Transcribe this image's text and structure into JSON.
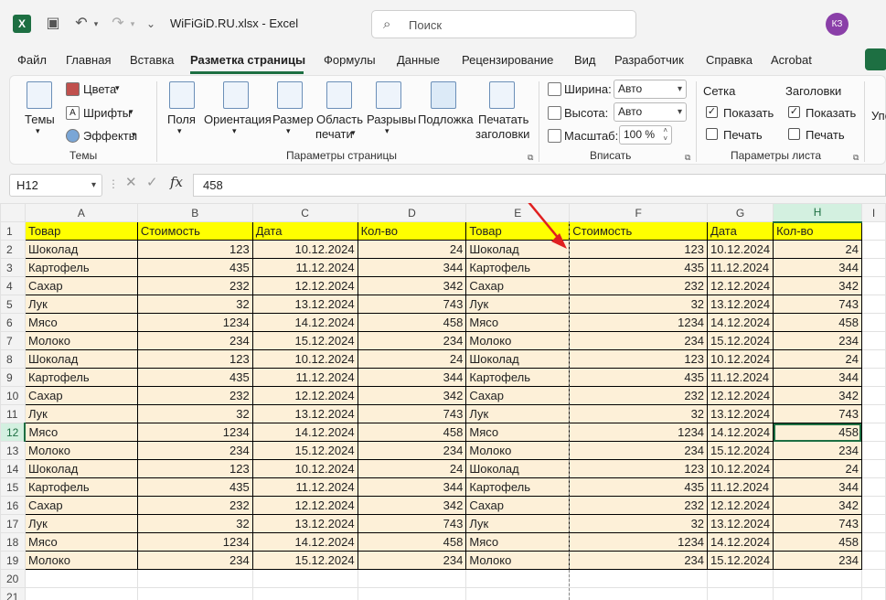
{
  "app": {
    "logo_letter": "X",
    "file_title": "WiFiGiD.RU.xlsx - Excel",
    "search_placeholder": "Поиск",
    "avatar_initials": "КЗ"
  },
  "tabs": [
    "Файл",
    "Главная",
    "Вставка",
    "Разметка страницы",
    "Формулы",
    "Данные",
    "Рецензирование",
    "Вид",
    "Разработчик",
    "Справка",
    "Acrobat"
  ],
  "active_tab": "Разметка страницы",
  "ribbon": {
    "themes": {
      "themes_label": "Темы",
      "colors": "Цвета",
      "fonts": "Шрифты",
      "effects": "Эффекты",
      "group": "Темы"
    },
    "page_setup": {
      "margins": "Поля",
      "orientation": "Ориентация",
      "size": "Размер",
      "print_area_1": "Область",
      "print_area_2": "печати",
      "breaks": "Разрывы",
      "background": "Подложка",
      "print_titles_1": "Печатать",
      "print_titles_2": "заголовки",
      "group": "Параметры страницы"
    },
    "scale_to_fit": {
      "width_label": "Ширина:",
      "width_value": "Авто",
      "height_label": "Высота:",
      "height_value": "Авто",
      "scale_label": "Масштаб:",
      "scale_value": "100 %",
      "group": "Вписать"
    },
    "sheet_options": {
      "gridlines": "Сетка",
      "headings": "Заголовки",
      "view": "Показать",
      "print": "Печать",
      "gridlines_view_checked": true,
      "gridlines_print_checked": false,
      "headings_view_checked": true,
      "headings_print_checked": false,
      "group": "Параметры листа"
    },
    "overflow_label": "Упо"
  },
  "formula_bar": {
    "name_box": "H12",
    "fx": "fx",
    "value": "458"
  },
  "sheet": {
    "columns": [
      "A",
      "B",
      "C",
      "D",
      "E",
      "F",
      "G",
      "H",
      "I"
    ],
    "selected_column": "H",
    "selected_row": 12,
    "header_row": [
      "Товар",
      "Стоимость",
      "Дата",
      "Кол-во",
      "Товар",
      "Стоимость",
      "Дата",
      "Кол-во"
    ],
    "rows": [
      [
        "Шоколад",
        "123",
        "10.12.2024",
        "24",
        "Шоколад",
        "123",
        "10.12.2024",
        "24"
      ],
      [
        "Картофель",
        "435",
        "11.12.2024",
        "344",
        "Картофель",
        "435",
        "11.12.2024",
        "344"
      ],
      [
        "Сахар",
        "232",
        "12.12.2024",
        "342",
        "Сахар",
        "232",
        "12.12.2024",
        "342"
      ],
      [
        "Лук",
        "32",
        "13.12.2024",
        "743",
        "Лук",
        "32",
        "13.12.2024",
        "743"
      ],
      [
        "Мясо",
        "1234",
        "14.12.2024",
        "458",
        "Мясо",
        "1234",
        "14.12.2024",
        "458"
      ],
      [
        "Молоко",
        "234",
        "15.12.2024",
        "234",
        "Молоко",
        "234",
        "15.12.2024",
        "234"
      ],
      [
        "Шоколад",
        "123",
        "10.12.2024",
        "24",
        "Шоколад",
        "123",
        "10.12.2024",
        "24"
      ],
      [
        "Картофель",
        "435",
        "11.12.2024",
        "344",
        "Картофель",
        "435",
        "11.12.2024",
        "344"
      ],
      [
        "Сахар",
        "232",
        "12.12.2024",
        "342",
        "Сахар",
        "232",
        "12.12.2024",
        "342"
      ],
      [
        "Лук",
        "32",
        "13.12.2024",
        "743",
        "Лук",
        "32",
        "13.12.2024",
        "743"
      ],
      [
        "Мясо",
        "1234",
        "14.12.2024",
        "458",
        "Мясо",
        "1234",
        "14.12.2024",
        "458"
      ],
      [
        "Молоко",
        "234",
        "15.12.2024",
        "234",
        "Молоко",
        "234",
        "15.12.2024",
        "234"
      ],
      [
        "Шоколад",
        "123",
        "10.12.2024",
        "24",
        "Шоколад",
        "123",
        "10.12.2024",
        "24"
      ],
      [
        "Картофель",
        "435",
        "11.12.2024",
        "344",
        "Картофель",
        "435",
        "11.12.2024",
        "344"
      ],
      [
        "Сахар",
        "232",
        "12.12.2024",
        "342",
        "Сахар",
        "232",
        "12.12.2024",
        "342"
      ],
      [
        "Лук",
        "32",
        "13.12.2024",
        "743",
        "Лук",
        "32",
        "13.12.2024",
        "743"
      ],
      [
        "Мясо",
        "1234",
        "14.12.2024",
        "458",
        "Мясо",
        "1234",
        "14.12.2024",
        "458"
      ],
      [
        "Молоко",
        "234",
        "15.12.2024",
        "234",
        "Молоко",
        "234",
        "15.12.2024",
        "234"
      ]
    ],
    "empty_rows": [
      20,
      21
    ],
    "numeric_columns": [
      1,
      3,
      5,
      7
    ],
    "right_aligned_columns": [
      1,
      2,
      3,
      5,
      7
    ]
  },
  "colors": {
    "excel_green": "#1d6f42",
    "header_fill": "#ffff00",
    "data_fill": "#fdf0d8",
    "arrow": "#e02020"
  }
}
